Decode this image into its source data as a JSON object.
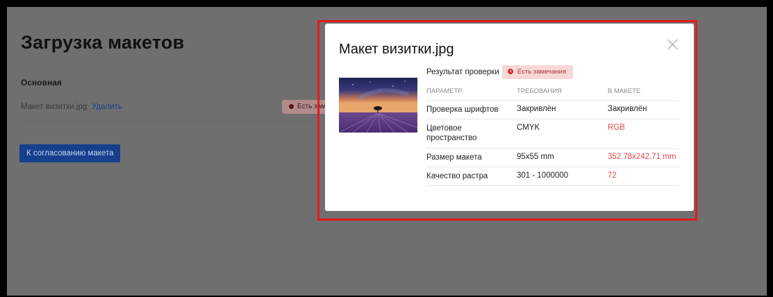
{
  "page": {
    "title": "Загрузка макетов",
    "section_label": "Основная",
    "file": {
      "name": "Макет визитки.jpg",
      "delete_label": "Удалить",
      "badge": "Есть замечания"
    },
    "approve_button": "К согласованию макета"
  },
  "modal": {
    "title": "Макет визитки.jpg",
    "close_icon": "close-icon",
    "result_label": "Результат проверки",
    "result_badge": "Есть замечания",
    "table": {
      "headers": [
        "ПАРАМЕТР",
        "ТРЕБОВАНИЯ",
        "В МАКЕТЕ"
      ],
      "rows": [
        {
          "param": "Проверка шрифтов",
          "required": "Закривлён",
          "actual": "Закривлён",
          "status": "ok"
        },
        {
          "param": "Цветовое пространство",
          "required": "CMYK",
          "actual": "RGB",
          "status": "error"
        },
        {
          "param": "Размер макета",
          "required": "95x55 mm",
          "actual": "352.78x242.71 mm",
          "status": "error"
        },
        {
          "param": "Качество растра",
          "required": "301 - 1000000",
          "actual": "72",
          "status": "error"
        }
      ]
    }
  },
  "colors": {
    "overlay": "#6f6f6f",
    "highlight": "#e8191b",
    "primary_button": "#163f8e",
    "error_text": "#e0474a",
    "badge_bg": "#f8d7d7"
  }
}
